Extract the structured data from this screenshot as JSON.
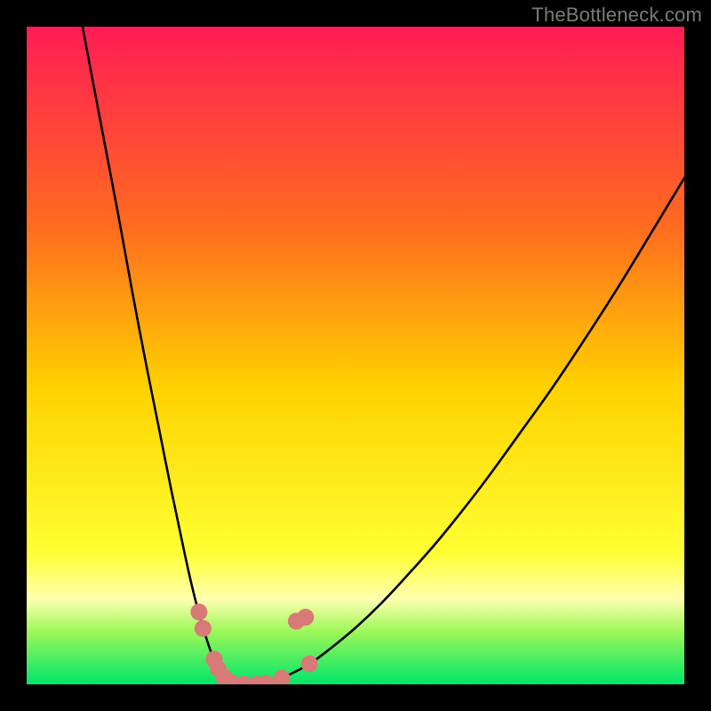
{
  "watermark": {
    "text": "TheBottleneck.com"
  },
  "colors": {
    "background": "#000000",
    "grad_top": "#ff1c55",
    "grad_upper": "#ff4d2a",
    "grad_mid": "#ffd200",
    "grad_lower": "#ffff33",
    "grad_band_pale": "#ffffb0",
    "grad_bottom": "#00e56a",
    "curve": "#000000",
    "marker_fill": "#d87a77",
    "marker_stroke": "#b85b56"
  },
  "chart_data": {
    "type": "line",
    "title": "",
    "xlabel": "",
    "ylabel": "",
    "xlim": [
      0,
      100
    ],
    "ylim": [
      0,
      100
    ],
    "series": [
      {
        "name": "curve-left",
        "x": [
          8.5,
          10,
          12,
          14,
          16,
          18,
          20,
          22,
          24,
          25,
          26,
          27,
          28,
          29,
          30,
          31,
          31.5
        ],
        "y": [
          100,
          92,
          81.5,
          71,
          60,
          49.5,
          39.5,
          29.5,
          20,
          15.5,
          11.5,
          8,
          5,
          2.5,
          1,
          0.3,
          0
        ]
      },
      {
        "name": "curve-flat",
        "x": [
          31.5,
          33,
          35,
          36.5
        ],
        "y": [
          0,
          0,
          0,
          0
        ]
      },
      {
        "name": "curve-right",
        "x": [
          36.5,
          38,
          40,
          43,
          46,
          50,
          54,
          58,
          62,
          66,
          70,
          75,
          80,
          85,
          90,
          95,
          100
        ],
        "y": [
          0,
          0.5,
          1.5,
          3.1,
          5.3,
          8.6,
          12.4,
          16.7,
          21.2,
          26.1,
          31.3,
          38.2,
          45.2,
          52.7,
          60.5,
          68.7,
          77.0
        ]
      }
    ],
    "markers": [
      {
        "series": "curve",
        "x": 26.2,
        "y": 11.0
      },
      {
        "series": "curve",
        "x": 26.8,
        "y": 8.5
      },
      {
        "series": "curve",
        "x": 28.5,
        "y": 3.8
      },
      {
        "series": "curve",
        "x": 30.0,
        "y": 1.1
      },
      {
        "series": "curve",
        "x": 31.2,
        "y": 0.2
      },
      {
        "series": "curve",
        "x": 33.0,
        "y": 0.0
      },
      {
        "series": "curve",
        "x": 35.0,
        "y": 0.0
      },
      {
        "series": "curve",
        "x": 36.4,
        "y": 0.1
      },
      {
        "series": "curve",
        "x": 38.8,
        "y": 0.9
      },
      {
        "series": "curve",
        "x": 29.1,
        "y": 2.4
      },
      {
        "series": "curve",
        "x": 43.0,
        "y": 3.1
      },
      {
        "series": "curve",
        "x": 41.0,
        "y": 9.6
      },
      {
        "series": "curve",
        "x": 42.4,
        "y": 10.2
      }
    ],
    "gradient_stops": [
      {
        "pos": 0.0,
        "color": "#ff1c55"
      },
      {
        "pos": 0.3,
        "color": "#ff6a20"
      },
      {
        "pos": 0.55,
        "color": "#ffd200"
      },
      {
        "pos": 0.8,
        "color": "#ffff33"
      },
      {
        "pos": 0.87,
        "color": "#ffffb0"
      },
      {
        "pos": 0.92,
        "color": "#9df759"
      },
      {
        "pos": 1.0,
        "color": "#00e56a"
      }
    ]
  }
}
